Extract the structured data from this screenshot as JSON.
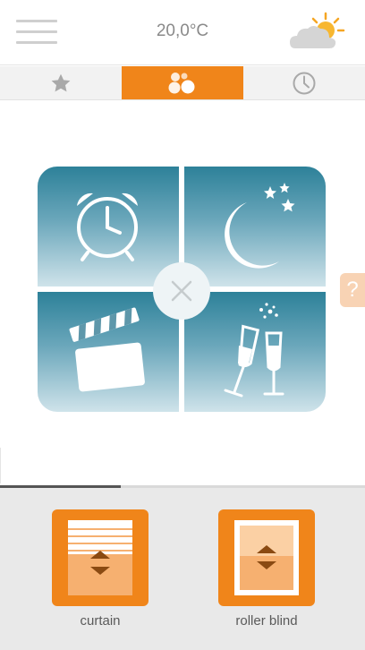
{
  "header": {
    "menu_icon": "hamburger-menu-icon",
    "temperature": "20,0°C",
    "weather_icon": "partly-sunny-icon"
  },
  "tabs": [
    {
      "icon": "star-icon",
      "active": false
    },
    {
      "icon": "scenes-icon",
      "active": true
    },
    {
      "icon": "clock-icon",
      "active": false
    }
  ],
  "scenes": [
    {
      "icon": "alarm-clock-icon"
    },
    {
      "icon": "moon-stars-icon"
    },
    {
      "icon": "clapperboard-icon"
    },
    {
      "icon": "champagne-glasses-icon"
    }
  ],
  "help": {
    "label": "?"
  },
  "page_progress": 0.33,
  "devices": [
    {
      "label": "curtain",
      "icon": "curtain-icon"
    },
    {
      "label": "roller blind",
      "icon": "roller-blind-icon"
    }
  ],
  "colors": {
    "accent": "#f0851a",
    "tile_top": "#2d8199",
    "tile_bottom": "#cfe3ea"
  }
}
